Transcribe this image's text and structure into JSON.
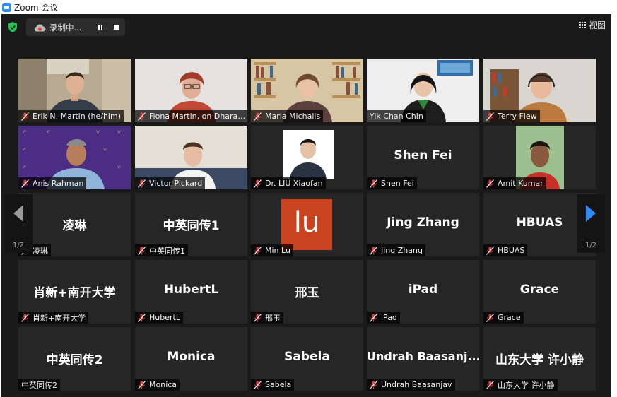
{
  "window": {
    "title": "Zoom 会议"
  },
  "toolbar": {
    "recording_label": "录制中...",
    "view_label": "视图"
  },
  "pagination": {
    "left_indicator": "1/2",
    "right_indicator": "1/2"
  },
  "colors": {
    "accent": "#2d8cff",
    "active_speaker_border": "#e0e878",
    "muted_mic": "#e0443e",
    "background": "#1a1a1a",
    "tile": "#262626"
  },
  "participants": [
    {
      "name": "Erik N. Martin (he/him)",
      "video": true
    },
    {
      "name": "Fiona Martin, on Dharawal c...",
      "video": true
    },
    {
      "name": "Maria Michalis",
      "video": true
    },
    {
      "name": "Yik Chan Chin",
      "video": true,
      "active_speaker": true
    },
    {
      "name": "Terry Flew",
      "video": true
    },
    {
      "name": "Anis Rahman",
      "video": true
    },
    {
      "name": "Victor Pickard",
      "video": true
    },
    {
      "name": "Dr. LIU Xiaofan",
      "video": true
    },
    {
      "name": "Shen Fei",
      "display": "Shen Fei"
    },
    {
      "name": "Amit Kumar",
      "video": true
    },
    {
      "name": "凌琳",
      "display": "凌琳"
    },
    {
      "name": "中英同传1",
      "display": "中英同传1"
    },
    {
      "name": "Min Lu",
      "avatar_text": "lu"
    },
    {
      "name": "Jing Zhang",
      "display": "Jing Zhang"
    },
    {
      "name": "HBUAS",
      "display": "HBUAS"
    },
    {
      "name": "肖新+南开大学",
      "display": "肖新+南开大学"
    },
    {
      "name": "HubertL",
      "display": "HubertL"
    },
    {
      "name": "邢玉",
      "display": "邢玉"
    },
    {
      "name": "iPad",
      "display": "iPad"
    },
    {
      "name": "Grace",
      "display": "Grace"
    },
    {
      "name": "中英同传2",
      "display": "中英同传2"
    },
    {
      "name": "Monica",
      "display": "Monica"
    },
    {
      "name": "Sabela",
      "display": "Sabela"
    },
    {
      "name": "Undrah Baasanjav",
      "display": "Undrah  Baasanj..."
    },
    {
      "name": "山东大学 许小静",
      "display": "山东大学 许小静"
    }
  ]
}
